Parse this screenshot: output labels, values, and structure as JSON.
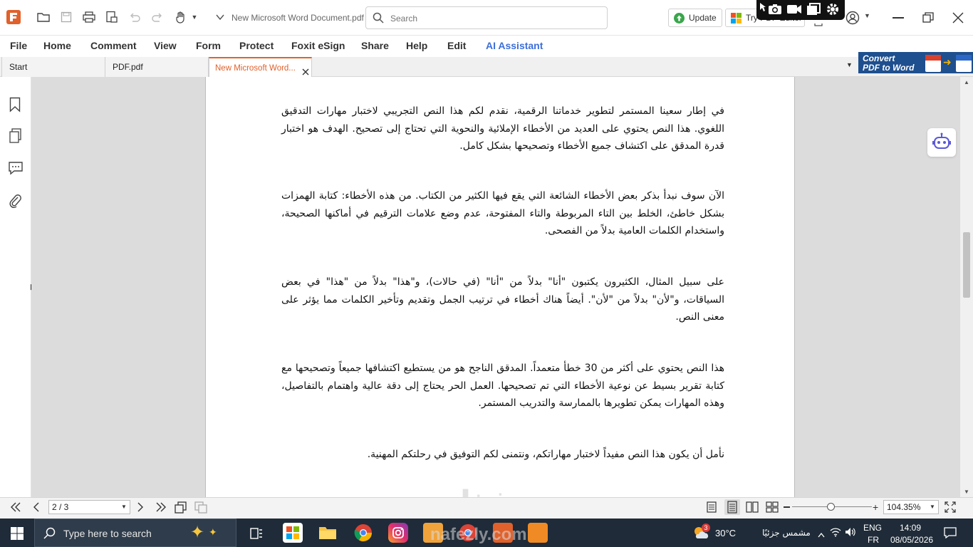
{
  "app": {
    "document_title": "New Microsoft Word Document.pdf",
    "logo_icon": "foxit-logo-icon",
    "accent_color": "#e0612b"
  },
  "titlebar": {
    "search_placeholder": "Search",
    "update_label": "Update",
    "try_editor_label": "Try PDF Editor"
  },
  "menu": {
    "items": [
      "File",
      "Home",
      "Comment",
      "View",
      "Form",
      "Protect",
      "Foxit eSign",
      "Share",
      "Help",
      "Edit",
      "AI Assistant"
    ]
  },
  "tabs": [
    {
      "label": "Start"
    },
    {
      "label": "PDF.pdf"
    },
    {
      "label": "New Microsoft Word..."
    }
  ],
  "convert_banner": {
    "line1": "Convert",
    "line2": "PDF to Word"
  },
  "document": {
    "paragraphs": [
      "في إطار سعينا المستمر لتطوير خدماتنا الرقمية، نقدم لكم هذا النص التجريبي لاختبار مهارات التدقيق اللغوي. هذا النص يحتوي على العديد من الأخطاء الإملائية والنحوية التي تحتاج إلى تصحيح. الهدف هو اختبار قدرة المدقق على اكتشاف جميع الأخطاء وتصحيحها بشكل كامل.",
      "الآن سوف نبدأ بذكر بعض الأخطاء الشائعة التي يقع فيها الكثير من الكتاب. من هذه الأخطاء: كتابة الهمزات بشكل خاطئ، الخلط بين التاء المربوطة والتاء المفتوحة، عدم وضع علامات الترقيم في أماكنها الصحيحة، واستخدام الكلمات العامية بدلاً من الفصحى.",
      "على سبيل المثال، الكثيرون يكتبون \"أنا\" بدلاً من \"أنا\" (في حالات)، و\"هذا\" بدلاً من \"هذا\" في بعض السياقات، و\"لأن\" بدلاً من \"لأن\". أيضاً هناك أخطاء في ترتيب الجمل وتقديم وتأخير الكلمات مما يؤثر على معنى النص.",
      "هذا النص يحتوي على أكثر من 30 خطأ متعمداً. المدقق الناجح هو من يستطيع اكتشافها جميعاً وتصحيحها مع كتابة تقرير بسيط عن نوعية الأخطاء التي تم تصحيحها. العمل الحر يحتاج إلى دقة عالية واهتمام بالتفاصيل، وهذه المهارات يمكن تطويرها بالممارسة والتدريب المستمر.",
      "نأمل أن يكون هذا النص مفيداً لاختبار مهاراتكم، ونتمنى لكم التوفيق في رحلتكم المهنية."
    ]
  },
  "statusbar": {
    "page_indicator": "2 / 3",
    "zoom_level": "104.35%"
  },
  "taskbar": {
    "search_placeholder": "Type here to search",
    "weather_temp": "30°C",
    "weather_desc": "مشمس جزئيًا",
    "weather_badge": "3",
    "language": "ENG",
    "locale": "FR",
    "time": "14:09",
    "date": "08/05/2026"
  },
  "watermark": {
    "arabic": "نفذلي",
    "latin": "nafezly.com"
  }
}
